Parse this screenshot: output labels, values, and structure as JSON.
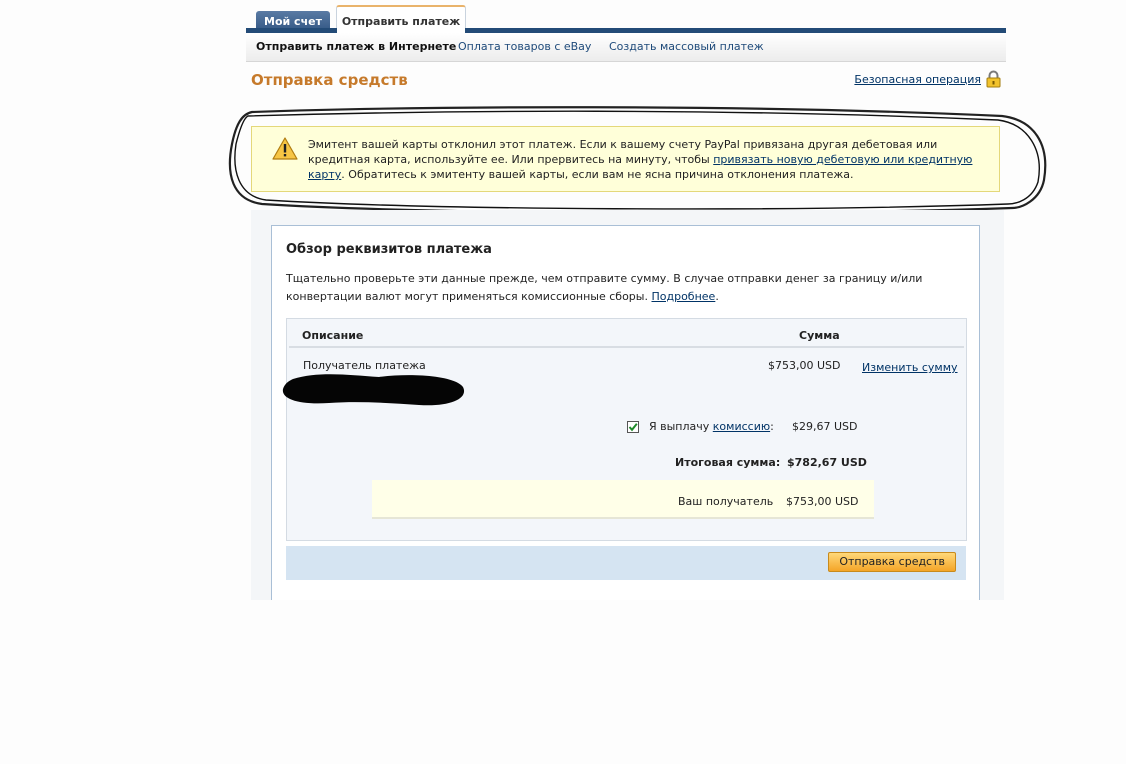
{
  "tabs": {
    "my_account": "Мой счет",
    "send_payment": "Отправить платеж"
  },
  "subnav": {
    "item1": "Отправить платеж в Интернете",
    "item2": "Оплата товаров с eBay",
    "item3": "Создать массовый платеж"
  },
  "page": {
    "title": "Отправка средств",
    "secure_link": "Безопасная операция"
  },
  "warning": {
    "text_before": "Эмитент вашей карты отклонил этот платеж. Если к вашему счету PayPal привязана другая дебетовая или кредитная карта, используйте ее. Или прервитесь на минуту, чтобы ",
    "link": "привязать новую дебетовую или кредитную карту",
    "text_after": ". Обратитесь к эмитенту вашей карты, если вам не ясна причина отклонения платежа."
  },
  "review": {
    "title": "Обзор реквизитов платежа",
    "desc_before": "Тщательно проверьте эти данные прежде, чем отправите сумму. В случае отправки денег за границу и/или конвертации валют могут применяться комиссионные сборы. ",
    "more_link": "Подробнее",
    "desc_after": ".",
    "col_description": "Описание",
    "col_amount": "Сумма",
    "recipient_label": "Получатель платежа",
    "recipient_amount": "$753,00 USD",
    "change_amount": "Изменить сумму",
    "fee_before": "Я выплачу ",
    "fee_link": "комиссию",
    "fee_after": ":",
    "fee_amount": "$29,67 USD",
    "fee_checked": true,
    "total_label": "Итоговая сумма:",
    "total_amount": "$782,67 USD",
    "receives_label": "Ваш получатель",
    "receives_amount": "$753,00 USD"
  },
  "actions": {
    "send_button": "Отправка средств"
  },
  "colors": {
    "accent_title": "#c67a2b",
    "tab_bar": "#234b77",
    "button": "#f4a528"
  }
}
